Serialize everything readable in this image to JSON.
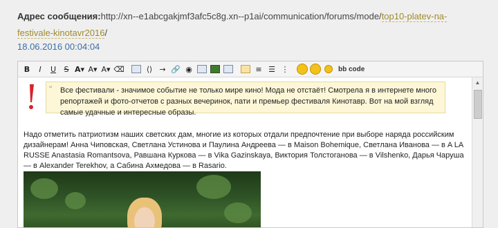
{
  "address": {
    "label": "Адрес сообщения:",
    "url_plain": "http://xn--e1abcgakjmf3afc5c8g.xn--p1ai/communication/forums/mode/",
    "url_link": "top10-platev-na-festivale-kinotavr2016",
    "url_tail": "/"
  },
  "date": "18.06.2016 00:04:04",
  "toolbar": {
    "bold": "B",
    "italic": "I",
    "underline": "U",
    "strike": "S",
    "font": "A",
    "size": "A",
    "bbcode": "bb code"
  },
  "quote": "Все фестивали - значимое событие не только  мире кино! Мода не отстаёт! Смотрела я в интернете много репортажей и фото-отчетов с разных вечеринок, пати и премьер фестиваля Кинотавр. Вот на мой взгляд самые удачные и интересные образы.",
  "paragraph": "Надо отметить патриотизм наших светских дам, многие из которых отдали предпочтение при выборе наряда российским дизайнерам! Анна Чиповская, Светлана Устинова и Паулина Андреева — в Maison Bohemique, Светлана Иванова — в A LA RUSSE Anastasia Romantsova, Равшана Куркова — в Vika Gazinskaya, Виктория Толстоганова — в Vilshenko, Дарья Чаруша — в Alexander Terekhov, а Сабина Ахмедова — в Rasario.",
  "colors": {
    "accent_link": "#a08a2a",
    "date": "#3b6ea5",
    "quote_bg": "#fdf7d8",
    "exclaim": "#d8232a"
  }
}
